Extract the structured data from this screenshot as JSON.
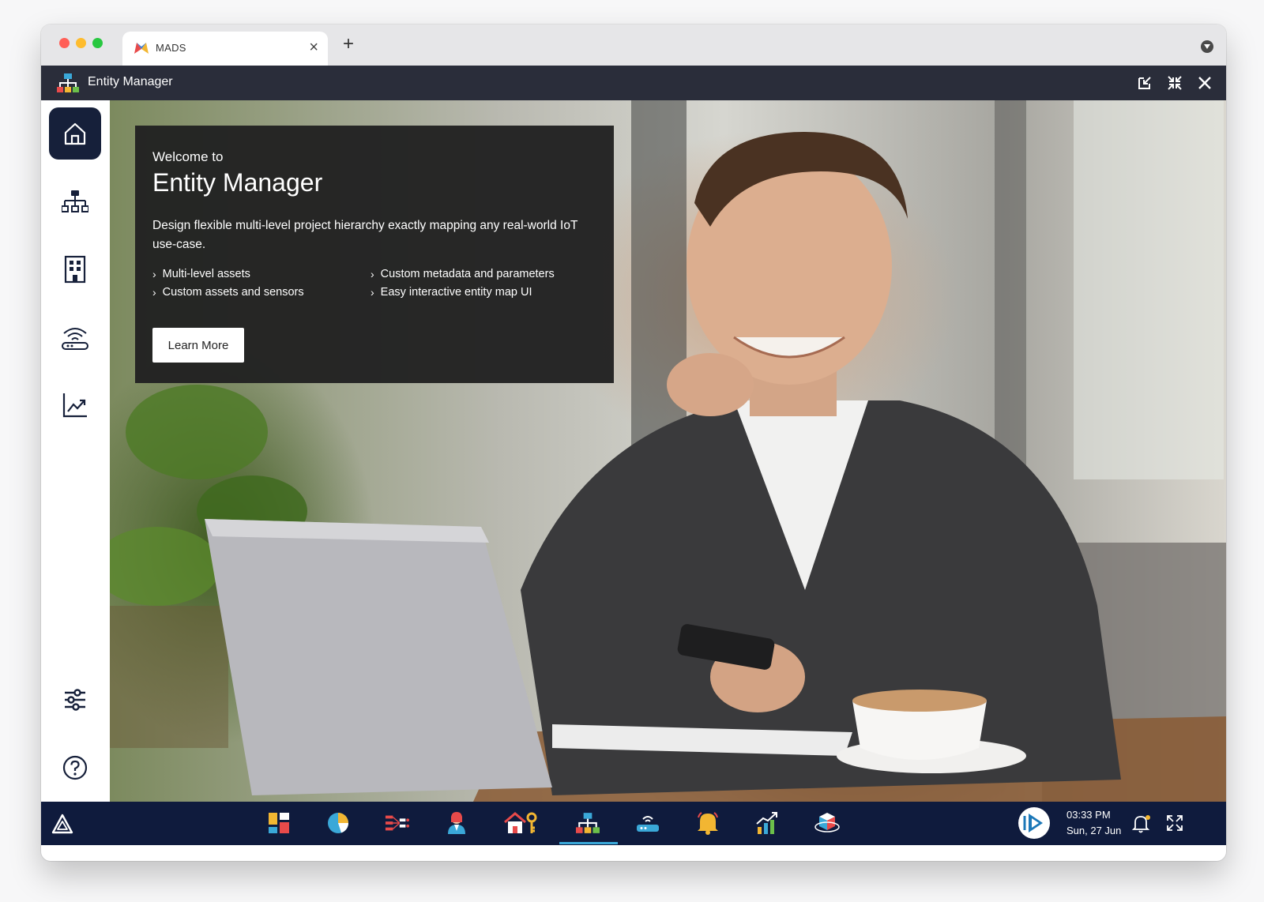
{
  "browser": {
    "tab_title": "MADS",
    "tab_close": "×",
    "new_tab": "+"
  },
  "app": {
    "title": "Entity Manager"
  },
  "sidebar": {
    "items": [
      {
        "icon": "home-icon",
        "active": true
      },
      {
        "icon": "hierarchy-icon",
        "active": false
      },
      {
        "icon": "building-icon",
        "active": false
      },
      {
        "icon": "router-icon",
        "active": false
      },
      {
        "icon": "analytics-icon",
        "active": false
      },
      {
        "icon": "settings-sliders-icon",
        "active": false
      },
      {
        "icon": "help-icon",
        "active": false
      }
    ]
  },
  "welcome": {
    "pre_title": "Welcome to",
    "title": "Entity Manager",
    "description": "Design flexible multi-level project hierarchy exactly mapping any real-world IoT use-case.",
    "features": [
      "Multi-level assets",
      "Custom assets and sensors",
      "Custom metadata and parameters",
      "Easy interactive entity map UI"
    ],
    "cta_label": "Learn More"
  },
  "taskbar": {
    "apps": [
      "dashboard-icon",
      "pie-chart-icon",
      "data-flow-icon",
      "user-icon",
      "home-key-icon",
      "entity-hierarchy-icon",
      "gateway-icon",
      "bell-alert-icon",
      "growth-chart-icon",
      "cube-network-icon"
    ],
    "active_app": "entity-hierarchy-icon",
    "time": "03:33 PM",
    "date": "Sun, 27 Jun"
  },
  "colors": {
    "header_bg": "#2a2d3a",
    "taskbar_bg": "#0f1b3d",
    "sidebar_active_bg": "#16203a",
    "card_bg": "#222222",
    "taskbar_active_line": "#3aa8d8"
  }
}
